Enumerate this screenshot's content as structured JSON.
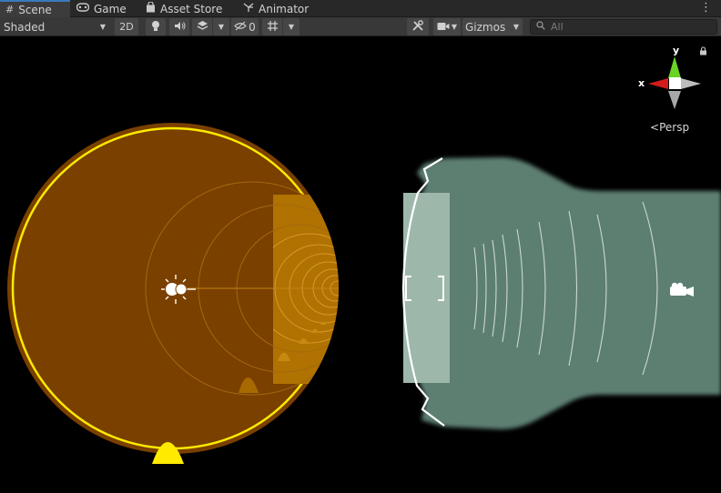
{
  "tabs": [
    {
      "label": "Scene",
      "icon": "grid-icon",
      "active": true
    },
    {
      "label": "Game",
      "icon": "gamepad-icon"
    },
    {
      "label": "Asset Store",
      "icon": "store-bag-icon"
    },
    {
      "label": "Animator",
      "icon": "animator-icon"
    }
  ],
  "toolbar": {
    "shading_mode": "Shaded",
    "mode_2d": "2D",
    "hidden_count": "0",
    "gizmos_label": "Gizmos",
    "search_placeholder": "All"
  },
  "orientation_gizmo": {
    "x_label": "x",
    "y_label": "y",
    "projection_label": "Persp"
  },
  "colors": {
    "accent": "#3a79bb",
    "light_cone_fill": "#7a4000",
    "light_range_ring": "#ffea00",
    "spot_cone_fill": "#b07200",
    "camera_frustum": "#5d7f72",
    "camera_near_plane": "#9db8ab",
    "axis_x": "#d41b1b",
    "axis_y": "#6ad324"
  }
}
